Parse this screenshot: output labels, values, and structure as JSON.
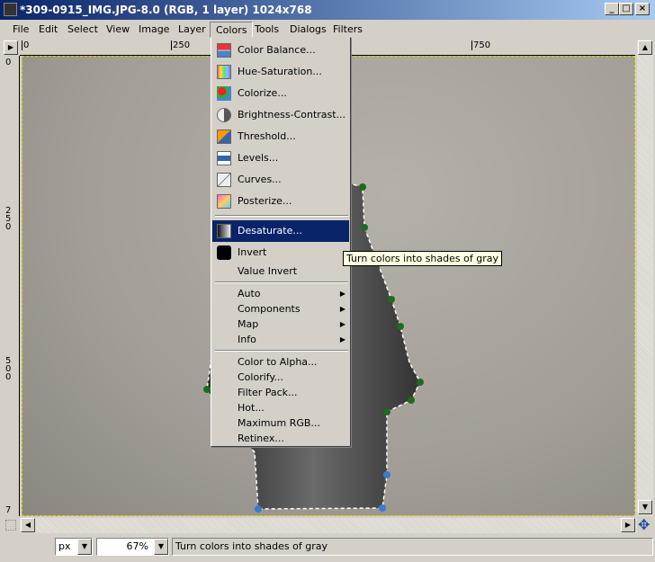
{
  "window": {
    "title": "*309-0915_IMG.JPG-8.0 (RGB, 1 layer) 1024x768",
    "controls": [
      "_",
      "□",
      "×"
    ]
  },
  "menubar": [
    {
      "label": "File"
    },
    {
      "label": "Edit"
    },
    {
      "label": "Select"
    },
    {
      "label": "View"
    },
    {
      "label": "Image"
    },
    {
      "label": "Layer"
    },
    {
      "label": "Colors",
      "active": true
    },
    {
      "label": "Tools"
    },
    {
      "label": "Dialogs"
    },
    {
      "label": "Filters"
    }
  ],
  "rulers": {
    "top": [
      "0",
      "250",
      "750"
    ],
    "left": [
      "0",
      "250",
      "500",
      "7"
    ]
  },
  "colors_menu": {
    "group1": [
      "Color Balance...",
      "Hue-Saturation...",
      "Colorize...",
      "Brightness-Contrast...",
      "Threshold...",
      "Levels...",
      "Curves...",
      "Posterize..."
    ],
    "group2": [
      "Desaturate...",
      "Invert",
      "Value Invert"
    ],
    "highlighted": "Desaturate...",
    "submenus": [
      "Auto",
      "Components",
      "Map",
      "Info"
    ],
    "plugins": [
      "Color to Alpha...",
      "Colorify...",
      "Filter Pack...",
      "Hot...",
      "Maximum RGB...",
      "Retinex..."
    ]
  },
  "tooltip": "Turn colors into shades of gray",
  "statusbar": {
    "unit": "px",
    "zoom": "67%",
    "message": "Turn colors into shades of gray"
  },
  "accent": "#0a246a"
}
